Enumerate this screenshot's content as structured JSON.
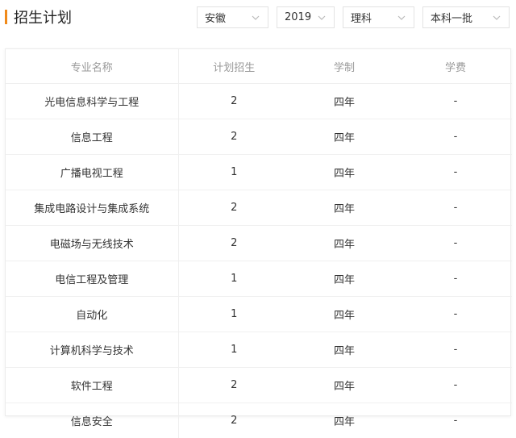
{
  "header": {
    "title": "招生计划"
  },
  "filters": [
    {
      "value": "安徽"
    },
    {
      "value": "2019"
    },
    {
      "value": "理科"
    },
    {
      "value": "本科一批"
    }
  ],
  "table": {
    "columns": [
      "专业名称",
      "计划招生",
      "学制",
      "学费"
    ],
    "rows": [
      [
        "光电信息科学与工程",
        "2",
        "四年",
        "-"
      ],
      [
        "信息工程",
        "2",
        "四年",
        "-"
      ],
      [
        "广播电视工程",
        "1",
        "四年",
        "-"
      ],
      [
        "集成电路设计与集成系统",
        "2",
        "四年",
        "-"
      ],
      [
        "电磁场与无线技术",
        "2",
        "四年",
        "-"
      ],
      [
        "电信工程及管理",
        "1",
        "四年",
        "-"
      ],
      [
        "自动化",
        "1",
        "四年",
        "-"
      ],
      [
        "计算机科学与技术",
        "1",
        "四年",
        "-"
      ],
      [
        "软件工程",
        "2",
        "四年",
        "-"
      ],
      [
        "信息安全",
        "2",
        "四年",
        "-"
      ]
    ]
  },
  "colors": {
    "accent": "#f08a1a"
  },
  "icons": {
    "dropdown": "chevron-down-icon"
  }
}
